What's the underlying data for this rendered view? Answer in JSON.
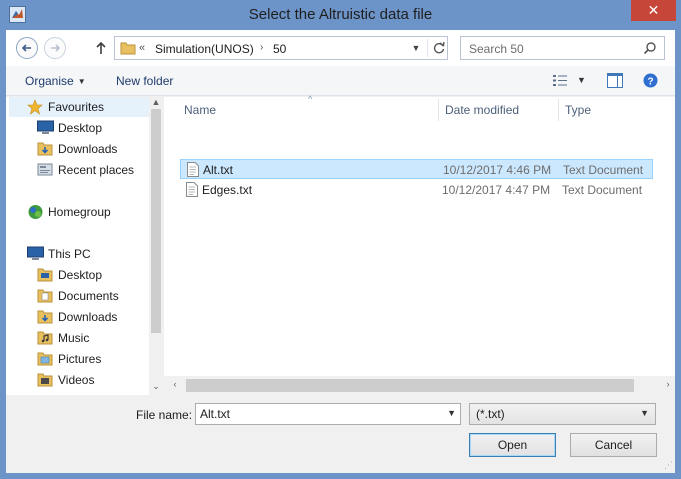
{
  "window": {
    "title": "Select the Altruistic data file",
    "close_label": "✕"
  },
  "address": {
    "chevron": "«",
    "crumbs": [
      "Simulation(UNOS)",
      "50"
    ],
    "separator": "›"
  },
  "search": {
    "placeholder": "Search 50"
  },
  "toolbar": {
    "organise_label": "Organise",
    "new_folder_label": "New folder"
  },
  "nav_pane": {
    "favourites": {
      "label": "Favourites",
      "items": [
        "Desktop",
        "Downloads",
        "Recent places"
      ]
    },
    "homegroup": {
      "label": "Homegroup"
    },
    "this_pc": {
      "label": "This PC",
      "items": [
        "Desktop",
        "Documents",
        "Downloads",
        "Music",
        "Pictures",
        "Videos"
      ]
    }
  },
  "file_list": {
    "columns": [
      "Name",
      "Date modified",
      "Type"
    ],
    "rows": [
      {
        "name": "Alt.txt",
        "date": "10/12/2017 4:46 PM",
        "type": "Text Document",
        "selected": true
      },
      {
        "name": "Edges.txt",
        "date": "10/12/2017 4:47 PM",
        "type": "Text Document",
        "selected": false
      }
    ]
  },
  "footer": {
    "file_name_label": "File name:",
    "file_name_value": "Alt.txt",
    "file_type_value": "(*.txt)",
    "open_label": "Open",
    "cancel_label": "Cancel"
  },
  "colors": {
    "title_bar": "#6d94c8",
    "close_button": "#c7463a",
    "selection": "#cce8ff",
    "folder": "#e8c060"
  }
}
